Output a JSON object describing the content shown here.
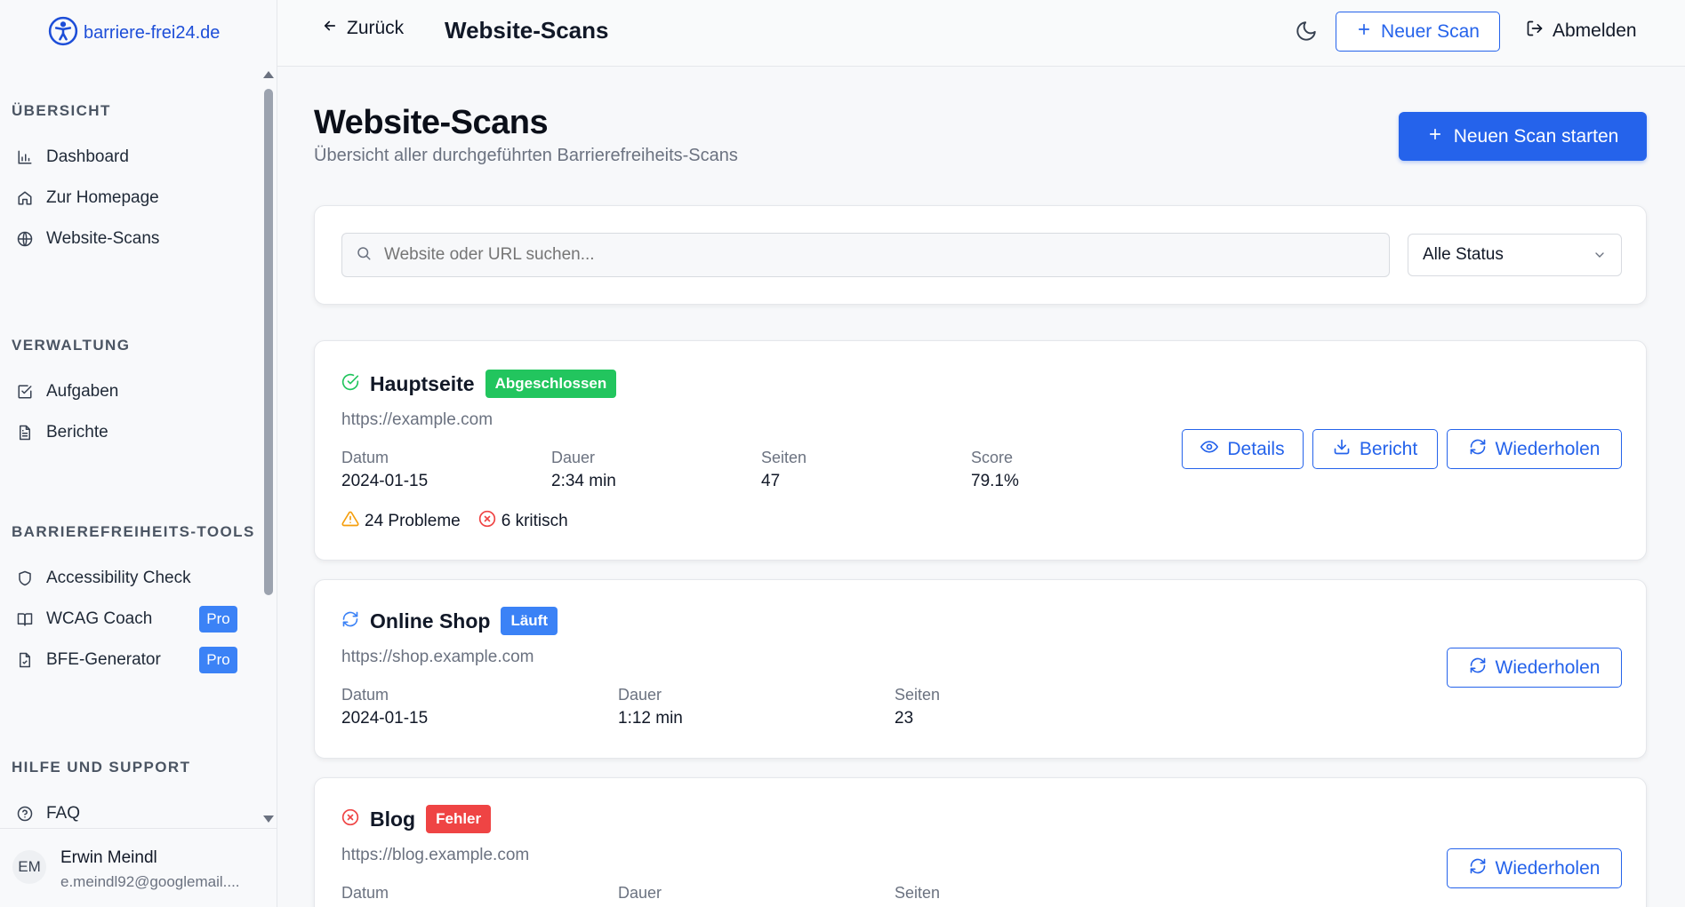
{
  "app": {
    "logo_text": "barriere-frei24.de"
  },
  "sidebar": {
    "sections": [
      {
        "title": "ÜBERSICHT",
        "items": [
          {
            "label": "Dashboard",
            "icon": "bar-chart-icon"
          },
          {
            "label": "Zur Homepage",
            "icon": "home-icon"
          },
          {
            "label": "Website-Scans",
            "icon": "globe-icon"
          }
        ]
      },
      {
        "title": "VERWALTUNG",
        "items": [
          {
            "label": "Aufgaben",
            "icon": "checkbox-icon"
          },
          {
            "label": "Berichte",
            "icon": "document-icon"
          }
        ]
      },
      {
        "title": "BARRIEREFREIHEITS-TOOLS",
        "items": [
          {
            "label": "Accessibility Check",
            "icon": "shield-icon"
          },
          {
            "label": "WCAG Coach",
            "icon": "book-icon",
            "badge": "Pro"
          },
          {
            "label": "BFE-Generator",
            "icon": "file-icon",
            "badge": "Pro"
          }
        ]
      },
      {
        "title": "HILFE UND SUPPORT",
        "items": [
          {
            "label": "FAQ",
            "icon": "help-circle-icon"
          }
        ]
      }
    ],
    "user": {
      "initials": "EM",
      "name": "Erwin Meindl",
      "email": "e.meindl92@googlemail...."
    }
  },
  "header": {
    "back_label": "Zurück",
    "title": "Website-Scans",
    "new_scan_label": "Neuer Scan",
    "logout_label": "Abmelden"
  },
  "main": {
    "title": "Website-Scans",
    "subtitle": "Übersicht aller durchgeführten Barrierefreiheits-Scans",
    "start_button": "Neuen Scan starten",
    "search_placeholder": "Website oder URL suchen...",
    "status_filter": "Alle Status"
  },
  "scans": [
    {
      "name": "Hauptseite",
      "status": "Abgeschlossen",
      "status_color": "#22c55e",
      "url": "https://example.com",
      "labels": {
        "date": "Datum",
        "duration": "Dauer",
        "pages": "Seiten",
        "score": "Score"
      },
      "date": "2024-01-15",
      "duration": "2:34 min",
      "pages": "47",
      "score": "79.1%",
      "problems": "24 Probleme",
      "critical": "6 kritisch",
      "actions": {
        "details": "Details",
        "report": "Bericht",
        "repeat": "Wiederholen"
      }
    },
    {
      "name": "Online Shop",
      "status": "Läuft",
      "status_color": "#3b82f6",
      "url": "https://shop.example.com",
      "labels": {
        "date": "Datum",
        "duration": "Dauer",
        "pages": "Seiten"
      },
      "date": "2024-01-15",
      "duration": "1:12 min",
      "pages": "23",
      "actions": {
        "repeat": "Wiederholen"
      }
    },
    {
      "name": "Blog",
      "status": "Fehler",
      "status_color": "#ef4444",
      "url": "https://blog.example.com",
      "labels": {
        "date": "Datum",
        "duration": "Dauer",
        "pages": "Seiten"
      },
      "actions": {
        "repeat": "Wiederholen"
      }
    }
  ]
}
